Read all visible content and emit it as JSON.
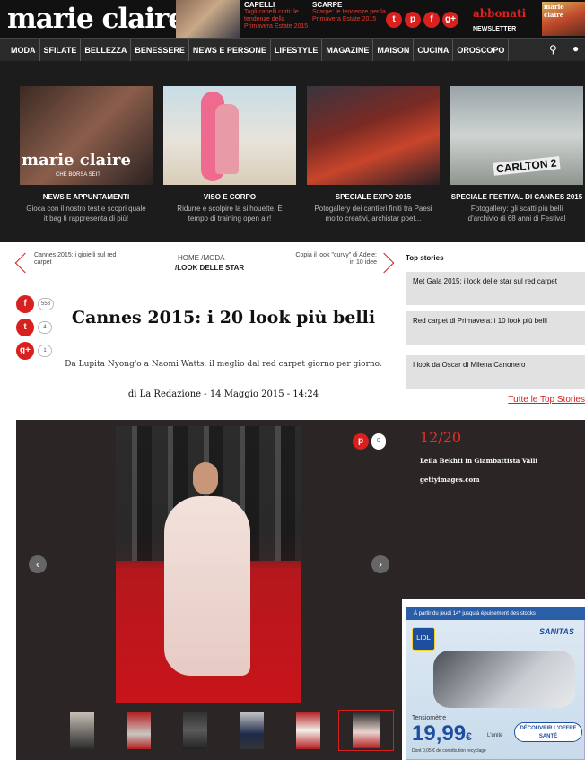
{
  "header": {
    "logo": "marie claire",
    "promos": [
      {
        "category": "CAPELLI",
        "title": "Tagli capelli corti: le tendenze della Primavera Estate 2015"
      },
      {
        "category": "SCARPE",
        "title": "Scarpe: le tendenze per la Primavera Estate 2015"
      }
    ],
    "social": [
      {
        "icon": "twitter-icon",
        "glyph": "t"
      },
      {
        "icon": "pinterest-icon",
        "glyph": "p"
      },
      {
        "icon": "facebook-icon",
        "glyph": "f"
      },
      {
        "icon": "google-plus-icon",
        "glyph": "g+"
      }
    ],
    "subscribe": "abbonati",
    "newsletter": "NEWSLETTER",
    "magazine_cover": "marie claire"
  },
  "nav": {
    "items": [
      "MODA",
      "SFILATE",
      "BELLEZZA",
      "BENESSERE",
      "NEWS E PERSONE",
      "LIFESTYLE",
      "MAGAZINE",
      "MAISON",
      "CUCINA",
      "OROSCOPO"
    ],
    "search_icon": "⚲",
    "user_icon": "●"
  },
  "banner": {
    "cards": [
      {
        "category": "NEWS E APPUNTAMENTI",
        "desc": "Gioca con il nostro test e scopri quale it bag ti rappresenta di più!",
        "image_logo": "marie claire",
        "image_sub": "CHE BORSA SEI?"
      },
      {
        "category": "VISO E CORPO",
        "desc": "Ridurre e scolpire la silhouette. È tempo di training open air!"
      },
      {
        "category": "SPECIALE EXPO 2015",
        "desc": "Potogallery dei cantieri finiti tra Paesi molto creativi, archistar poet..."
      },
      {
        "category": "SPECIALE FESTIVAL DI CANNES 2015",
        "desc": "Fotogallery: gli scatti più belli d'archivio di 68 anni di Festival",
        "image_sign": "CARLTON 2"
      }
    ]
  },
  "article": {
    "prev": "Cannes 2015: i gioielli sul red carpet",
    "next": "Copia il look \"curvy\" di Adele: in 10 idee",
    "breadcrumb_1": "HOME  /MODA",
    "breadcrumb_2": "/LOOK DELLE STAR",
    "title": "Cannes 2015: i 20 look più belli",
    "subtitle": "Da Lupita Nyong'o a Naomi Watts, il meglio dal red carpet giorno per giorno.",
    "byline_prefix": "di",
    "author": "La Redazione",
    "date": "- 14 Maggio 2015 - 14:24",
    "share": [
      {
        "icon": "facebook-icon",
        "glyph": "f",
        "count": "558"
      },
      {
        "icon": "twitter-icon",
        "glyph": "t",
        "count": "4"
      },
      {
        "icon": "google-plus-icon",
        "glyph": "g+",
        "count": "1"
      }
    ]
  },
  "top_stories": {
    "heading": "Top stories",
    "items": [
      "Met Gala 2015: i look delle star sul red carpet",
      "Red carpet di Primavera: i 10 look più belli",
      "I look da Oscar di Milena Canonero"
    ],
    "all_link": "Tutte le Top Stories"
  },
  "gallery": {
    "counter": "12/20",
    "caption": "Leila Bekhti in Giambattista Valli",
    "credit": "gettyimages.com",
    "pin_glyph": "p",
    "pin_count": "0",
    "prev_glyph": "‹",
    "next_glyph": "›",
    "thumbnail_count": 6,
    "active_thumbnail": 6
  },
  "ad": {
    "top_text": "À partir du jeudi 14* jusqu'à épuisement des stocks",
    "brand": "LIDL",
    "product_brand": "SANITAS",
    "label": "Tensiomètre",
    "price": "19,99",
    "currency": "€",
    "unit": "L'unité",
    "eco": "Dont 0,05 € de contribution recyclage",
    "cta": "DÉCOUVRIR L'OFFRE SANTÉ"
  }
}
